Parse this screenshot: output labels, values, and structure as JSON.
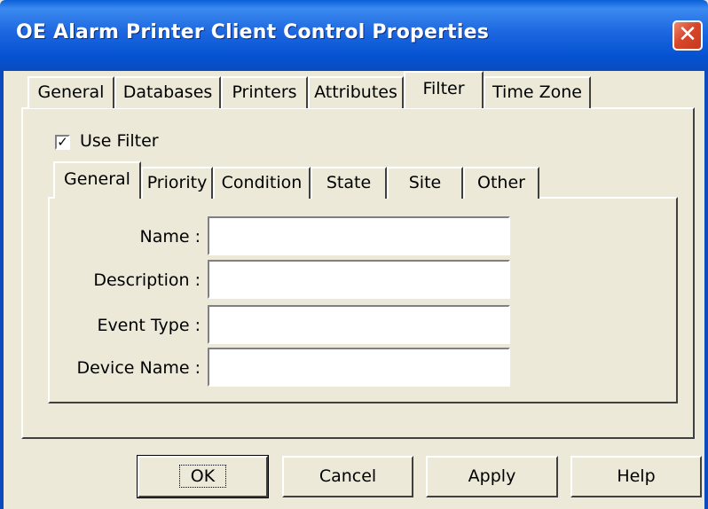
{
  "window": {
    "title": "OE Alarm Printer Client Control Properties",
    "close_glyph": "✕"
  },
  "tabs": [
    "General",
    "Databases",
    "Printers",
    "Attributes",
    "Filter",
    "Time Zone"
  ],
  "active_tab": "Filter",
  "filter": {
    "use_filter_label": "Use Filter",
    "use_filter_checked": true,
    "check_glyph": "✓",
    "subtabs": [
      "General",
      "Priority",
      "Condition",
      "State",
      "Site",
      "Other"
    ],
    "active_subtab": "General",
    "fields": [
      {
        "label": "Name :",
        "value": ""
      },
      {
        "label": "Description :",
        "value": ""
      },
      {
        "label": "Event Type :",
        "value": ""
      },
      {
        "label": "Device Name :",
        "value": ""
      }
    ]
  },
  "buttons": {
    "ok": "OK",
    "cancel": "Cancel",
    "apply": "Apply",
    "help": "Help"
  },
  "colors": {
    "titlebar": "#0a5fd8",
    "dialog_bg": "#ece9d8",
    "close": "#d9462a"
  }
}
